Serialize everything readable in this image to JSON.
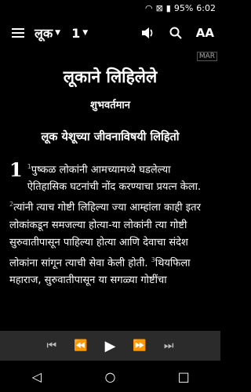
{
  "status_bar": {
    "wifi_icon": "wifi-icon",
    "sim_icon": "sim-icon",
    "battery": "95%",
    "time": "6:02"
  },
  "toolbar": {
    "book": "लूक",
    "chapter": "1",
    "text_size_label": "AA"
  },
  "content": {
    "mar_badge": "MAR",
    "title": "लूकाने लिहिलेले",
    "subtitle": "शुभवर्तमान",
    "section_heading": "लूक येशूच्या जीवनाविषयी लिहितो",
    "chapter_number": "1",
    "verses": [
      {
        "num": "1",
        "text": "पुष्कळ लोकांनी आमच्यामध्ये घडलेल्या ऐतिहासिक घटनांची नोंद करण्याचा प्रयत्न केला. "
      },
      {
        "num": "2",
        "text": "त्यांनी त्याच गोष्टी लिहिल्या ज्या आम्हांला काही इतर लोकांकडून समजल्या होत्या-या लोकांनी त्या गोष्टी सुरुवातीपासून पाहिल्या होत्या आणि देवाचा संदेश लोकांना सांगून त्याची सेवा केली होती. "
      },
      {
        "num": "3",
        "text": "थियफिला महाराज, सुरुवातीपासून या सगळ्या गोष्टींचा"
      }
    ]
  },
  "player": {
    "first": "⏮",
    "rewind": "⏪",
    "play": "▶",
    "forward": "⏩",
    "last": "⏭"
  },
  "navbar": {
    "back": "◁",
    "home": "○",
    "recents": "□"
  }
}
